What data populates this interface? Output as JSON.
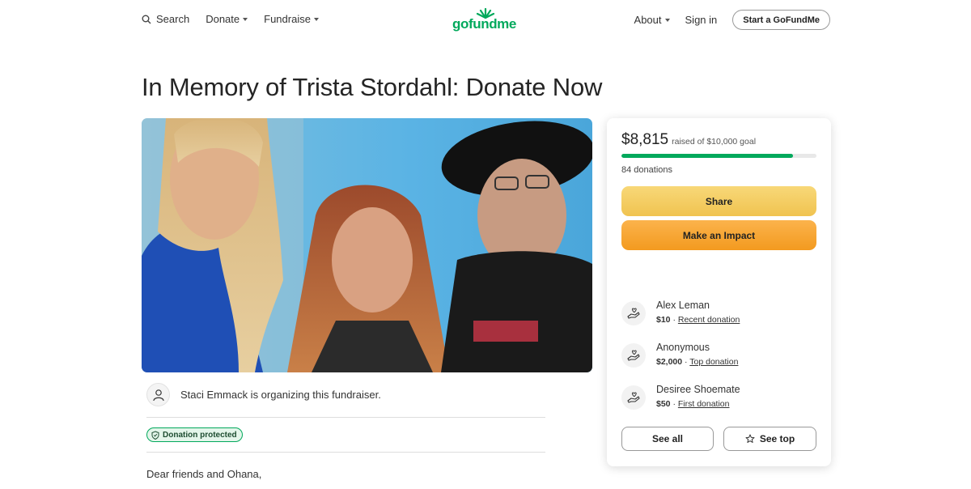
{
  "header": {
    "search_label": "Search",
    "donate_label": "Donate",
    "fundraise_label": "Fundraise",
    "logo_text": "gofundme",
    "about_label": "About",
    "signin_label": "Sign in",
    "start_label": "Start a GoFundMe"
  },
  "campaign": {
    "title": "In Memory of Trista Stordahl: Donate Now",
    "organizer_text": "Staci Emmack is organizing this fundraiser.",
    "protected_label": "Donation protected",
    "story_start": "Dear friends and Ohana,"
  },
  "progress": {
    "raised": "$8,815",
    "goal_text": "raised of $10,000 goal",
    "fraction": 0.88,
    "donations": "84 donations"
  },
  "buttons": {
    "share": "Share",
    "impact": "Make an Impact",
    "see_all": "See all",
    "see_top": "See top"
  },
  "donations": [
    {
      "name": "Alex Leman",
      "amount": "$10",
      "tag": "Recent donation"
    },
    {
      "name": "Anonymous",
      "amount": "$2,000",
      "tag": "Top donation"
    },
    {
      "name": "Desiree Shoemate",
      "amount": "$50",
      "tag": "First donation"
    }
  ],
  "colors": {
    "brand_green": "#02a95c",
    "share_yellow": "#f4cd63",
    "impact_orange": "#f7a634"
  }
}
